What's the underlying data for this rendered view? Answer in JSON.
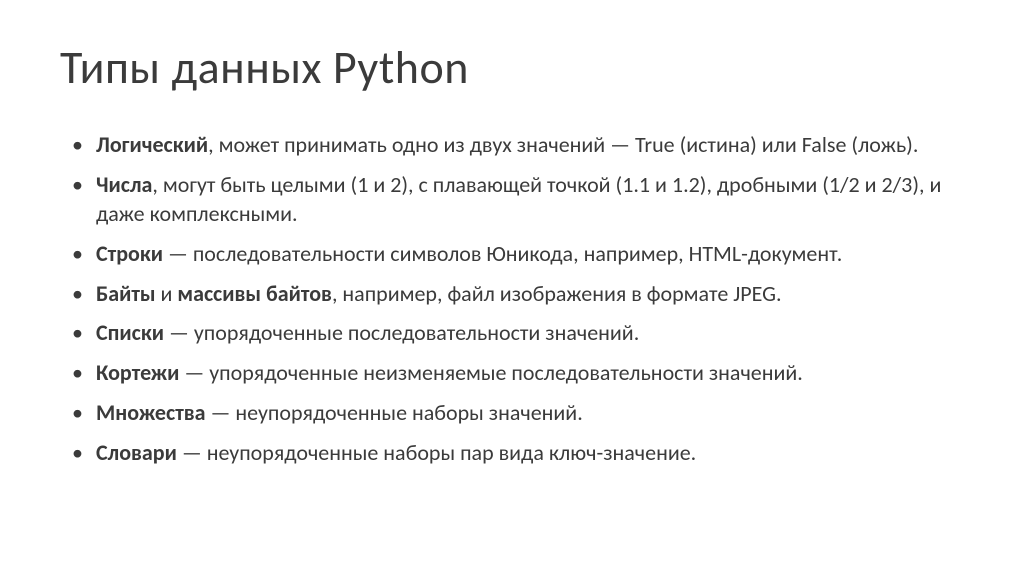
{
  "title": "Типы данных Python",
  "bullets": [
    {
      "bold": "Логический",
      "rest": ", может принимать одно из двух значений — True (истина) или False (ложь)."
    },
    {
      "bold": "Числа",
      "rest": ", могут быть целыми (1 и 2), с плавающей точкой (1.1 и 1.2), дробными (1/2 и 2/3), и даже комплексными."
    },
    {
      "bold": "Строки",
      "rest": " — последовательности символов Юникода, например, HTML-документ."
    },
    {
      "bold_parts": [
        "Байты",
        "массивы байтов"
      ],
      "joiner": " и ",
      "rest": ", например, файл изображения в формате JPEG."
    },
    {
      "bold": "Списки",
      "rest": " — упорядоченные последовательности значений."
    },
    {
      "bold": "Кортежи",
      "rest": " — упорядоченные неизменяемые последовательности значений."
    },
    {
      "bold": "Множества",
      "rest": " — неупорядоченные наборы значений."
    },
    {
      "bold": "Словари",
      "rest": " — неупорядоченные наборы пар вида ключ-значение."
    }
  ]
}
